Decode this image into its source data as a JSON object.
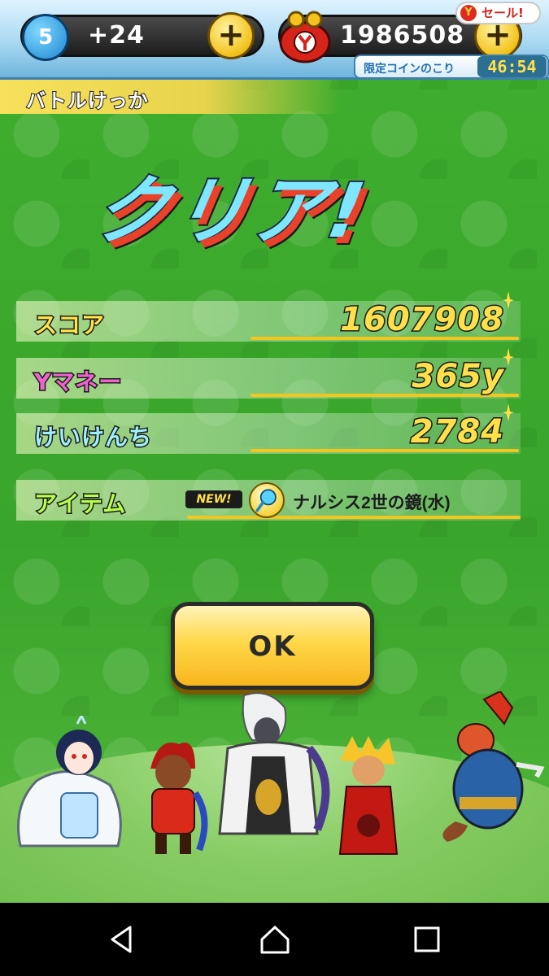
{
  "status_bar": {
    "stamina_level": "5",
    "stamina_bonus": "+24",
    "money": "1986508",
    "sale_badge": "セール!",
    "limited_coin_label": "限定コインのこり",
    "limited_coin_time": "46:54"
  },
  "header": {
    "title": "バトルけっか"
  },
  "banner": {
    "text": "クリア!"
  },
  "results": {
    "score_label": "スコア",
    "score_value": "1607908",
    "money_label": "Yマネー",
    "money_value": "365y",
    "exp_label": "けいけんち",
    "exp_value": "2784",
    "item_label": "アイテム",
    "item_new_badge": "NEW!",
    "item_name": "ナルシス2世の鏡(水)",
    "item_icon": "hand-mirror-icon"
  },
  "actions": {
    "ok_label": "OK"
  },
  "party": [
    "snow-yokai",
    "red-fire-yokai",
    "white-haired-boss-yokai",
    "blonde-flame-yokai",
    "fox-warrior-yokai"
  ],
  "nav": {
    "back": "back-icon",
    "home": "home-icon",
    "recent": "recent-apps-icon"
  },
  "colors": {
    "background": "#3fae2e",
    "accent_yellow": "#ffe04a",
    "ok_button": "#ffd84a"
  }
}
